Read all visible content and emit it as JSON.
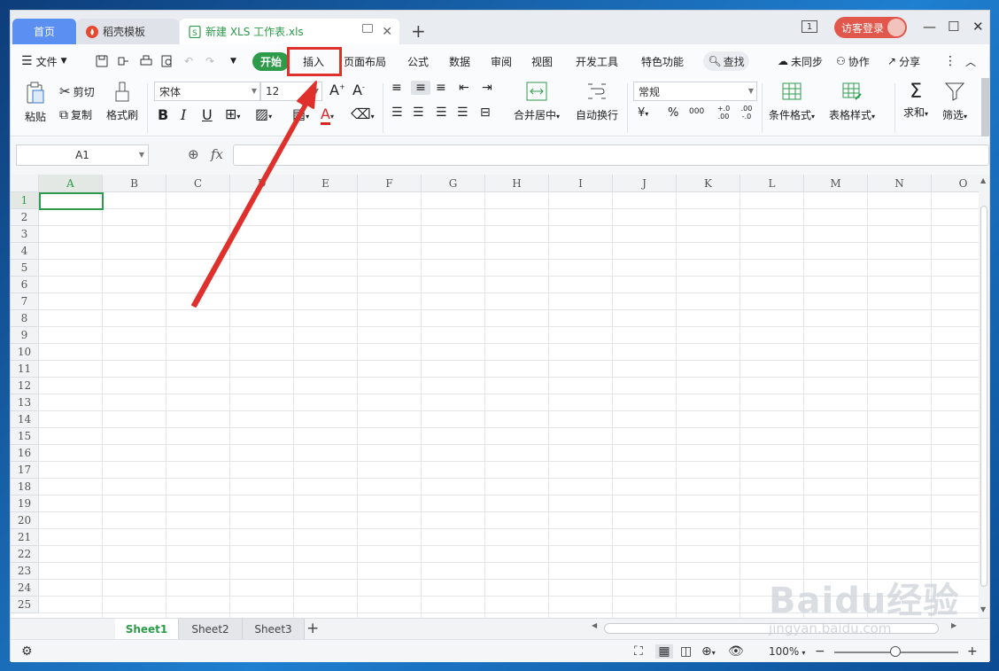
{
  "tabs": {
    "home": "首页",
    "template": "稻壳模板",
    "file": "新建 XLS 工作表.xls",
    "new_tab": "+"
  },
  "titlebar": {
    "window_num": "1",
    "visitor_login": "访客登录"
  },
  "menu": {
    "file": "文件",
    "start": "开始",
    "insert": "插入",
    "page_layout": "页面布局",
    "formula": "公式",
    "data": "数据",
    "review": "审阅",
    "view": "视图",
    "dev_tools": "开发工具",
    "special": "特色功能",
    "search": "查找",
    "unsynced": "未同步",
    "collab": "协作",
    "share": "分享"
  },
  "ribbon": {
    "paste": "粘贴",
    "cut": "剪切",
    "copy": "复制",
    "format_painter": "格式刷",
    "font_name": "宋体",
    "font_size": "12",
    "bold": "B",
    "italic": "I",
    "underline": "U",
    "font_color": "A",
    "merge_center": "合并居中",
    "wrap_text": "自动换行",
    "number_format": "常规",
    "currency": "¥",
    "percent": "%",
    "thousands": "000",
    "inc_decimal": "+.0 .00",
    "dec_decimal": ".00 -.0",
    "cond_format": "条件格式",
    "table_style": "表格样式",
    "sum": "求和",
    "filter": "筛选"
  },
  "formula_bar": {
    "cell_ref": "A1",
    "fx": "fx",
    "content": ""
  },
  "grid": {
    "columns": [
      "A",
      "B",
      "C",
      "D",
      "E",
      "F",
      "G",
      "H",
      "I",
      "J",
      "K",
      "L",
      "M",
      "N",
      "O"
    ],
    "rows": [
      "1",
      "2",
      "3",
      "4",
      "5",
      "6",
      "7",
      "8",
      "9",
      "10",
      "11",
      "12",
      "13",
      "14",
      "15",
      "16",
      "17",
      "18",
      "19",
      "20",
      "21",
      "22",
      "23",
      "24",
      "25"
    ],
    "selected_cell": "A1"
  },
  "sheets": {
    "tabs": [
      "Sheet1",
      "Sheet2",
      "Sheet3"
    ],
    "active": "Sheet1",
    "add": "+"
  },
  "status": {
    "zoom": "100%"
  },
  "watermark": {
    "brand": "Baidu经验",
    "url": "jingyan.baidu.com"
  },
  "colors": {
    "accent_green": "#2e9b4b",
    "home_tab_blue": "#5b8ff2",
    "visitor_red": "#e2574c",
    "annotation_red": "#e0302c"
  }
}
